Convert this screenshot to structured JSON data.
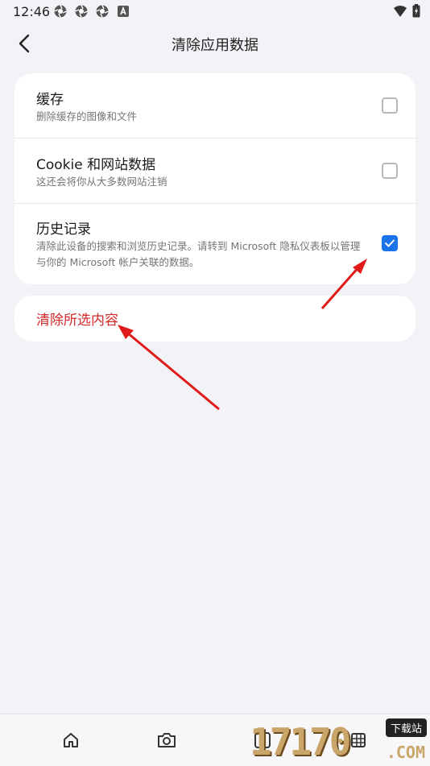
{
  "status_bar": {
    "time": "12:46"
  },
  "header": {
    "title": "清除应用数据"
  },
  "options": [
    {
      "title": "缓存",
      "subtitle": "删除缓存的图像和文件",
      "checked": false
    },
    {
      "title": "Cookie 和网站数据",
      "subtitle": "这还会将你从大多数网站注销",
      "checked": false
    },
    {
      "title": "历史记录",
      "subtitle": "清除此设备的搜索和浏览历史记录。请转到 Microsoft 隐私仪表板以管理与你的 Microsoft 帐户关联的数据。",
      "checked": true
    }
  ],
  "action": {
    "clear_label": "清除所选内容"
  },
  "bottom_nav": {
    "tab_count": "0"
  },
  "watermark": {
    "digits": "17170",
    "badge": "下载站",
    "domain": ".COM"
  },
  "colors": {
    "accent": "#1a73e8",
    "danger": "#d42a2a",
    "annotation": "#e01b1b"
  }
}
